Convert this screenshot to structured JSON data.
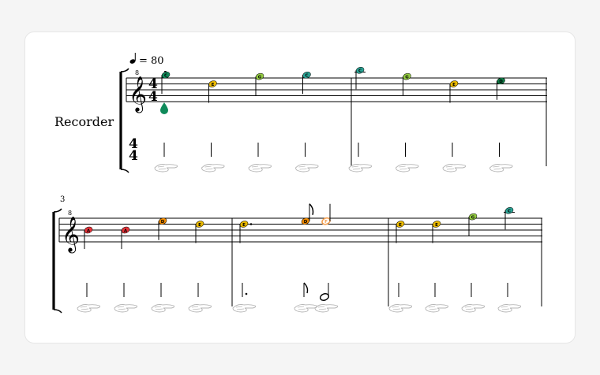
{
  "score": {
    "tempo_value": "= 80",
    "instrument_label": "Recorder",
    "time_signature": {
      "top": "4",
      "bottom": "4"
    },
    "clef_octave_mark": "8",
    "fingering_mark": "1",
    "system_2_measure_number": "3"
  },
  "notes": [
    {
      "measure": 1,
      "beat": 1,
      "pitch": "C",
      "label": "C",
      "color": "#0f8a5a",
      "duration": "quarter"
    },
    {
      "measure": 1,
      "beat": 2,
      "pitch": "E",
      "label": "E",
      "color": "#e9b800",
      "duration": "quarter"
    },
    {
      "measure": 1,
      "beat": 3,
      "pitch": "G",
      "label": "G",
      "color": "#93cc40",
      "duration": "quarter"
    },
    {
      "measure": 1,
      "beat": 4,
      "pitch": "C",
      "label": "C",
      "color": "#2aa394",
      "duration": "quarter"
    },
    {
      "measure": 2,
      "beat": 1,
      "pitch": "C",
      "label": "C",
      "color": "#2aa394",
      "duration": "quarter"
    },
    {
      "measure": 2,
      "beat": 2,
      "pitch": "G",
      "label": "G",
      "color": "#93cc40",
      "duration": "quarter"
    },
    {
      "measure": 2,
      "beat": 3,
      "pitch": "E",
      "label": "E",
      "color": "#e9b800",
      "duration": "quarter"
    },
    {
      "measure": 2,
      "beat": 4,
      "pitch": "D",
      "label": "D",
      "color": "#0f7a45",
      "duration": "quarter"
    },
    {
      "measure": 3,
      "beat": 1,
      "pitch": "A",
      "label": "A",
      "color": "#e8343a",
      "duration": "quarter"
    },
    {
      "measure": 3,
      "beat": 2,
      "pitch": "A",
      "label": "A",
      "color": "#e8343a",
      "duration": "quarter"
    },
    {
      "measure": 3,
      "beat": 3,
      "pitch": "D",
      "label": "D",
      "color": "#f08a00",
      "duration": "quarter"
    },
    {
      "measure": 3,
      "beat": 4,
      "pitch": "E",
      "label": "E",
      "color": "#e9b800",
      "duration": "quarter"
    },
    {
      "measure": 4,
      "beat": 1,
      "pitch": "E",
      "label": "E",
      "color": "#e9b800",
      "duration": "dotted-quarter"
    },
    {
      "measure": 4,
      "beat": 2.5,
      "pitch": "D",
      "label": "D",
      "color": "#f08a00",
      "duration": "eighth"
    },
    {
      "measure": 4,
      "beat": 3,
      "pitch": "F",
      "label": "F",
      "color": "#f5a050",
      "duration": "half"
    },
    {
      "measure": 5,
      "beat": 1,
      "pitch": "E",
      "label": "E",
      "color": "#e9b800",
      "duration": "quarter"
    },
    {
      "measure": 5,
      "beat": 2,
      "pitch": "E",
      "label": "E",
      "color": "#e9b800",
      "duration": "quarter"
    },
    {
      "measure": 5,
      "beat": 3,
      "pitch": "G",
      "label": "G",
      "color": "#93cc40",
      "duration": "quarter"
    },
    {
      "measure": 5,
      "beat": 4,
      "pitch": "C",
      "label": "C",
      "color": "#2aa394",
      "duration": "quarter"
    }
  ],
  "colors": {
    "staff_line": "#000000",
    "hand_stroke": "#b5b5b5",
    "thumb_fingering": "#0f8a5a"
  },
  "icons": {
    "quarter-note-icon": "♩",
    "treble-clef-icon": "𝄞",
    "fingering-hand-icon": "hand sketch"
  }
}
